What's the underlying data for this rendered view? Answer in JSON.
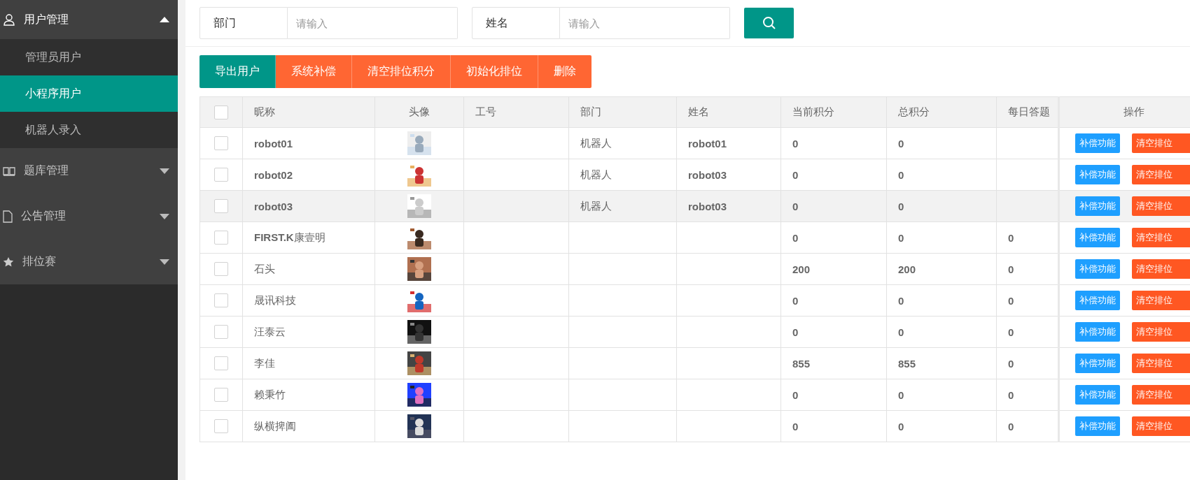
{
  "sidebar": {
    "groups": [
      {
        "label": "用户管理",
        "expanded": true,
        "children": [
          {
            "label": "管理员用户",
            "selected": false
          },
          {
            "label": "小程序用户",
            "selected": true
          },
          {
            "label": "机器人录入",
            "selected": false
          }
        ]
      },
      {
        "label": "题库管理",
        "expanded": false
      },
      {
        "label": "公告管理",
        "expanded": false
      },
      {
        "label": "排位赛",
        "expanded": false
      }
    ]
  },
  "search": {
    "fields": [
      {
        "label": "部门",
        "placeholder": "请输入"
      },
      {
        "label": "姓名",
        "placeholder": "请输入"
      }
    ]
  },
  "toolbar": {
    "buttons": [
      {
        "label": "导出用户",
        "kind": "primary"
      },
      {
        "label": "系统补偿",
        "kind": "warn"
      },
      {
        "label": "清空排位积分",
        "kind": "warn"
      },
      {
        "label": "初始化排位",
        "kind": "warn"
      },
      {
        "label": "删除",
        "kind": "warn"
      }
    ]
  },
  "table": {
    "all_checked": false,
    "columns": [
      "昵称",
      "头像",
      "工号",
      "部门",
      "姓名",
      "当前积分",
      "总积分",
      "每日答题",
      "操作"
    ],
    "rows": [
      {
        "checked": false,
        "hovered": false,
        "nickname": "robot01",
        "nickname_bold": true,
        "avatar": {
          "kind": "picture"
        },
        "dept": "机器人",
        "name": "robot01",
        "current": "0",
        "total": "0",
        "daily": "",
        "actions": [
          "补偿功能",
          "清空排位"
        ]
      },
      {
        "checked": false,
        "hovered": false,
        "nickname": "robot02",
        "nickname_bold": true,
        "avatar": {
          "kind": "picture"
        },
        "dept": "机器人",
        "name": "robot03",
        "current": "0",
        "total": "0",
        "daily": "",
        "actions": [
          "补偿功能",
          "清空排位"
        ]
      },
      {
        "checked": false,
        "hovered": true,
        "nickname": "robot03",
        "nickname_bold": true,
        "avatar": {
          "kind": "picture"
        },
        "dept": "机器人",
        "name": "robot03",
        "current": "0",
        "total": "0",
        "daily": "",
        "actions": [
          "补偿功能",
          "清空排位"
        ]
      },
      {
        "checked": false,
        "hovered": false,
        "nickname": "**FIRST.K**康壹明",
        "nickname_bold": false,
        "avatar": {
          "kind": "picture"
        },
        "dept": "",
        "name": "",
        "current": "0",
        "total": "0",
        "daily": "0",
        "actions": [
          "补偿功能",
          "清空排位"
        ]
      },
      {
        "checked": false,
        "hovered": false,
        "nickname": "石头",
        "nickname_bold": false,
        "avatar": {
          "kind": "picture"
        },
        "dept": "",
        "name": "",
        "current": "200",
        "total": "200",
        "daily": "0",
        "actions": [
          "补偿功能",
          "清空排位"
        ]
      },
      {
        "checked": false,
        "hovered": false,
        "nickname": "晟讯科技",
        "nickname_bold": false,
        "avatar": {
          "kind": "picture"
        },
        "dept": "",
        "name": "",
        "current": "0",
        "total": "0",
        "daily": "0",
        "actions": [
          "补偿功能",
          "清空排位"
        ]
      },
      {
        "checked": false,
        "hovered": false,
        "nickname": "汪泰云",
        "nickname_bold": false,
        "avatar": {
          "kind": "picture"
        },
        "dept": "",
        "name": "",
        "current": "0",
        "total": "0",
        "daily": "0",
        "actions": [
          "补偿功能",
          "清空排位"
        ]
      },
      {
        "checked": false,
        "hovered": false,
        "nickname": "李佳",
        "nickname_bold": false,
        "avatar": {
          "kind": "picture"
        },
        "dept": "",
        "name": "",
        "current": "855",
        "total": "855",
        "daily": "0",
        "actions": [
          "补偿功能",
          "清空排位"
        ]
      },
      {
        "checked": false,
        "hovered": false,
        "nickname": "赖秉竹",
        "nickname_bold": false,
        "avatar": {
          "kind": "picture"
        },
        "dept": "",
        "name": "",
        "current": "0",
        "total": "0",
        "daily": "0",
        "actions": [
          "补偿功能",
          "清空排位"
        ]
      },
      {
        "checked": false,
        "hovered": false,
        "nickname": "纵横捭阖",
        "nickname_bold": false,
        "avatar": {
          "kind": "picture"
        },
        "dept": "",
        "name": "",
        "current": "0",
        "total": "0",
        "daily": "0",
        "actions": [
          "补偿功能",
          "清空排位"
        ]
      }
    ]
  }
}
